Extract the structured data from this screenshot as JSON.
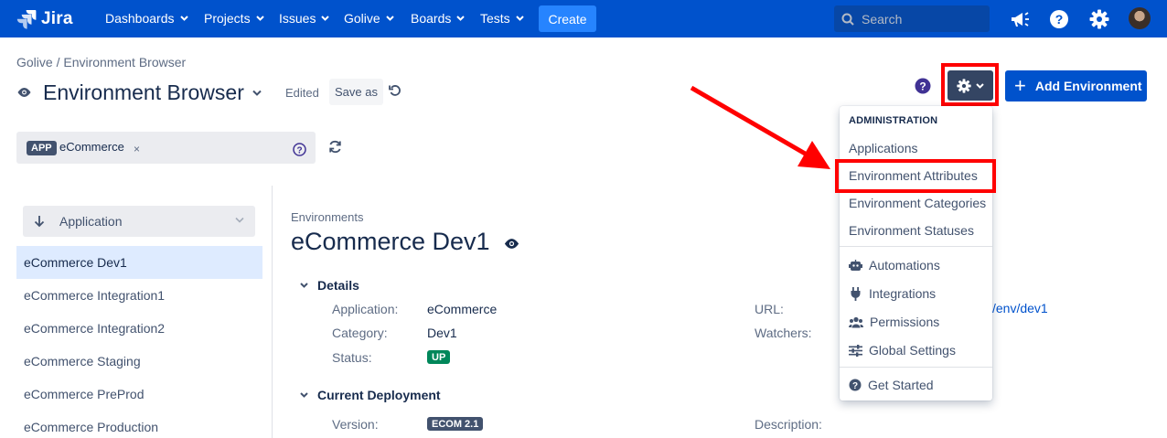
{
  "nav": {
    "logo_text": "Jira",
    "items": [
      {
        "label": "Dashboards"
      },
      {
        "label": "Projects"
      },
      {
        "label": "Issues"
      },
      {
        "label": "Golive"
      },
      {
        "label": "Boards"
      },
      {
        "label": "Tests"
      }
    ],
    "create_label": "Create",
    "search_placeholder": "Search"
  },
  "breadcrumb": "Golive / Environment Browser",
  "page": {
    "title": "Environment Browser",
    "edited_label": "Edited",
    "save_as_label": "Save as",
    "add_environment_label": "Add Environment"
  },
  "filter": {
    "tag_label": "APP",
    "tag_value": "eCommerce",
    "remove_glyph": "×"
  },
  "sidebar": {
    "sort_label": "Application",
    "environments": [
      {
        "label": "eCommerce Dev1",
        "selected": true
      },
      {
        "label": "eCommerce Integration1"
      },
      {
        "label": "eCommerce Integration2"
      },
      {
        "label": "eCommerce Staging"
      },
      {
        "label": "eCommerce PreProd"
      },
      {
        "label": "eCommerce Production"
      }
    ]
  },
  "detail": {
    "crumb": "Environments",
    "title": "eCommerce Dev1",
    "details_heading": "Details",
    "application_label": "Application:",
    "application_value": "eCommerce",
    "category_label": "Category:",
    "category_value": "Dev1",
    "status_label": "Status:",
    "status_value": "UP",
    "url_label": "URL:",
    "url_value": "/env/dev1",
    "watchers_label": "Watchers:",
    "deployment_heading": "Current Deployment",
    "version_label": "Version:",
    "version_value": "ECOM 2.1",
    "description_label": "Description:"
  },
  "menu": {
    "heading": "ADMINISTRATION",
    "admin_items": [
      {
        "label": "Applications"
      },
      {
        "label": "Environment Attributes",
        "highlighted": true
      },
      {
        "label": "Environment Categories"
      },
      {
        "label": "Environment Statuses"
      }
    ],
    "automations_label": "Automations",
    "integrations_label": "Integrations",
    "permissions_label": "Permissions",
    "global_settings_label": "Global Settings",
    "get_started_label": "Get Started"
  },
  "colors": {
    "nav_bg": "#0052cc",
    "create_bg": "#2684ff",
    "status_up": "#00875a",
    "annotation_red": "#ff0000",
    "selected_row": "#deebff"
  }
}
